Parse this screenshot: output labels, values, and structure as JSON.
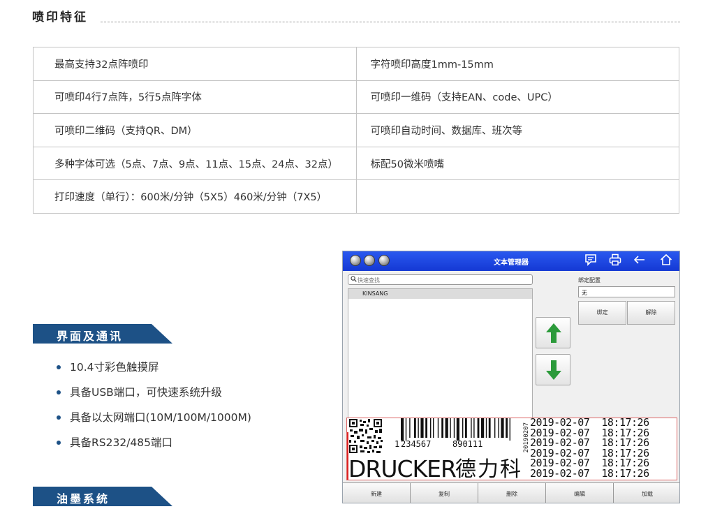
{
  "section_title": "喷印特征",
  "features": [
    [
      "最高支持32点阵喷印",
      "字符喷印高度1mm-15mm"
    ],
    [
      "可喷印4行7点阵，5行5点阵字体",
      "可喷印一维码（支持EAN、code、UPC）"
    ],
    [
      "可喷印二维码（支持QR、DM）",
      "可喷印自动时间、数据库、班次等"
    ],
    [
      "多种字体可选（5点、7点、9点、11点、15点、24点、32点）",
      "标配50微米喷嘴"
    ],
    [
      "打印速度（单行）：600米/分钟（5X5）460米/分钟（7X5）",
      ""
    ]
  ],
  "interface_title": "界面及通讯",
  "interface_items": [
    "10.4寸彩色触摸屏",
    "具备USB端口，可快速系统升级",
    "具备以太网端口(10M/100M/1000M)",
    "具备RS232/485端口"
  ],
  "ink_title": "油墨系统",
  "hmi": {
    "window_title": "文本管理器",
    "search_placeholder": "快速查找",
    "list_items": [
      "KINSANG"
    ],
    "bind_label": "绑定配置",
    "bind_value": "无",
    "bind_button": "绑定",
    "unbind_button": "解除",
    "toolbar": {
      "new": "新建",
      "copy": "复制",
      "delete": "删除",
      "edit": "编辑",
      "load": "加载"
    },
    "preview": {
      "barcode_first_digit": "1",
      "barcode_left_digits": "234567",
      "barcode_right_digits": "890111",
      "vertical_text": "20190207",
      "main_text": "DRUCKER",
      "cn_text": "德力科",
      "date_lines": [
        "2019-02-07  18:17:26",
        "2019-02-07  18:17:26",
        "2019-02-07  18:17:26",
        "2019-02-07  18:17:26",
        "2019-02-07  18:17:26",
        "2019-02-07  18:17:26"
      ]
    },
    "icons": [
      "message-icon",
      "printer-icon",
      "back-arrow-icon",
      "home-icon"
    ],
    "colors": {
      "titlebar": "#1e47e0",
      "ribbon": "#1d5186",
      "arrow_green": "#2b9a3a"
    }
  }
}
